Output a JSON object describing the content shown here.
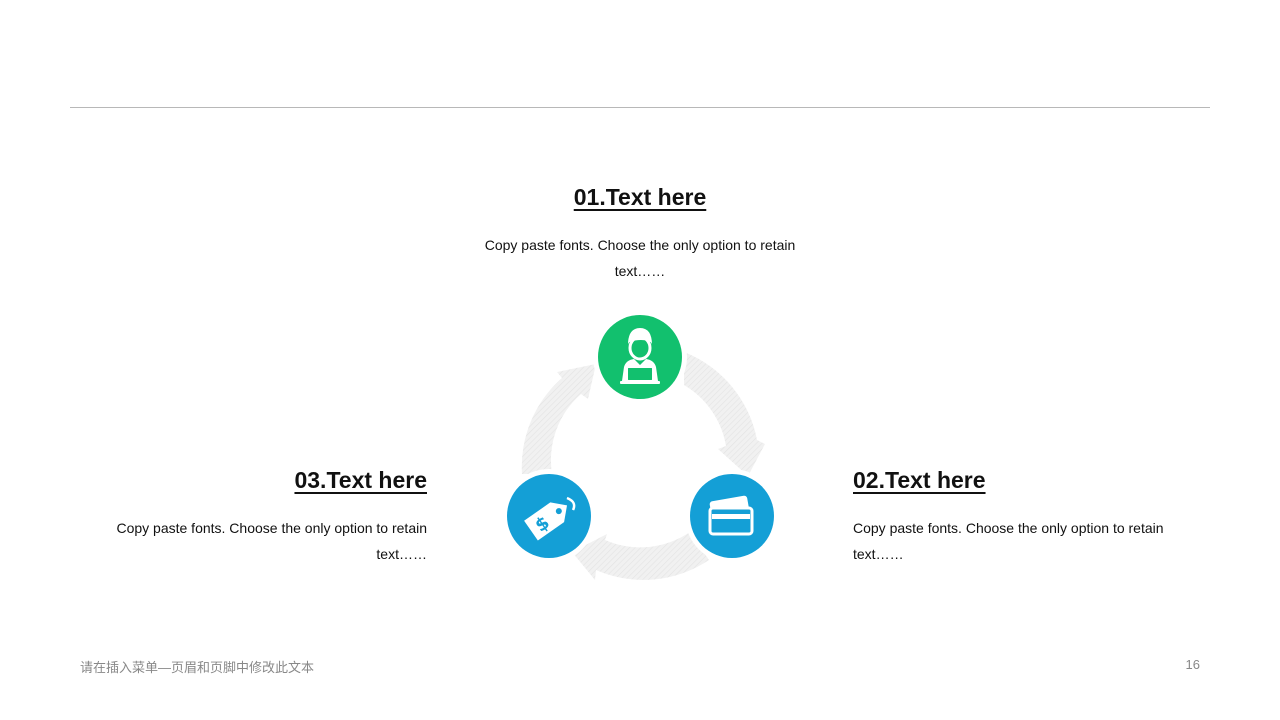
{
  "steps": [
    {
      "title": "01.Text here",
      "text": "Copy paste fonts. Choose the only option to retain text……",
      "icon": "presenter-laptop-icon",
      "color": "#12c06e"
    },
    {
      "title": "02.Text here",
      "text": "Copy paste fonts. Choose the only option to retain text……",
      "icon": "credit-card-icon",
      "color": "#149fd6"
    },
    {
      "title": "03.Text here",
      "text": "Copy paste fonts. Choose the only option to retain text……",
      "icon": "price-tag-icon",
      "color": "#149fd6"
    }
  ],
  "footer": {
    "text": "请在插入菜单—页眉和页脚中修改此文本",
    "page_number": "16"
  },
  "colors": {
    "arrow": "#ececec",
    "rule": "#b8b8b8"
  }
}
